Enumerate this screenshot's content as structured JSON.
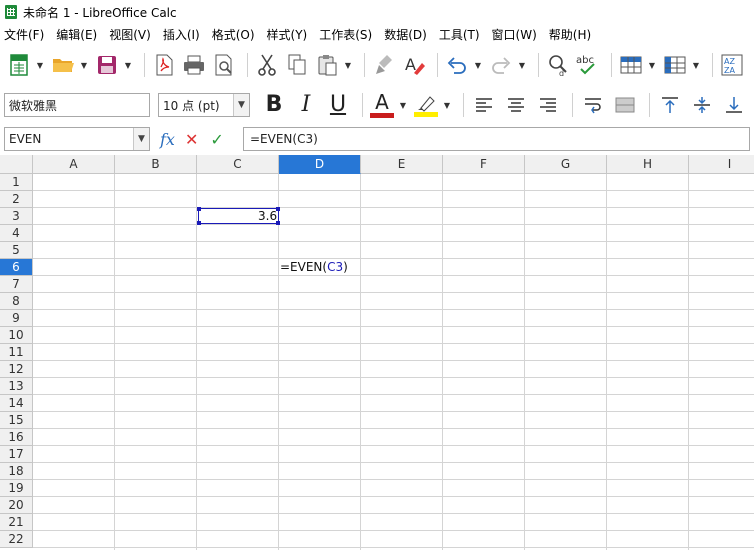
{
  "window": {
    "title": "未命名 1 - LibreOffice Calc"
  },
  "menu": [
    "文件(F)",
    "编辑(E)",
    "视图(V)",
    "插入(I)",
    "格式(O)",
    "样式(Y)",
    "工作表(S)",
    "数据(D)",
    "工具(T)",
    "窗口(W)",
    "帮助(H)"
  ],
  "toolbar": {
    "icons": [
      "new-spreadsheet-icon",
      "open-folder-icon",
      "save-icon",
      "export-pdf-icon",
      "print-icon",
      "print-preview-icon",
      "cut-icon",
      "copy-icon",
      "paste-icon",
      "clone-formatting-icon",
      "clear-formatting-icon",
      "undo-icon",
      "redo-icon",
      "find-replace-icon",
      "spellcheck-icon",
      "row-icon",
      "column-icon",
      "sort-icon"
    ],
    "spellcheck_text": "abc"
  },
  "format_bar": {
    "font_name": "微软雅黑",
    "font_size": "10 点 (pt)",
    "bold": "B",
    "italic": "I",
    "underline": "U",
    "font_color_letter": "A",
    "font_color": "#c91d1d",
    "highlight_color": "#ffee00"
  },
  "formula_bar": {
    "name_box": "EVEN",
    "fx": "fx",
    "cancel": "✕",
    "accept": "✓",
    "content": "=EVEN(C3)"
  },
  "sheet": {
    "columns": [
      "A",
      "B",
      "C",
      "D",
      "E",
      "F",
      "G",
      "H",
      "I"
    ],
    "active_column": "D",
    "rows": [
      "1",
      "2",
      "3",
      "4",
      "5",
      "6",
      "7",
      "8",
      "9",
      "10",
      "11",
      "12",
      "13",
      "14",
      "15",
      "16",
      "17",
      "18",
      "19",
      "20",
      "21",
      "22"
    ],
    "active_row": "6",
    "cell_c3": "3.6",
    "cell_d6_prefix": "=EVEN(",
    "cell_d6_ref": "C3",
    "cell_d6_suffix": ")"
  }
}
